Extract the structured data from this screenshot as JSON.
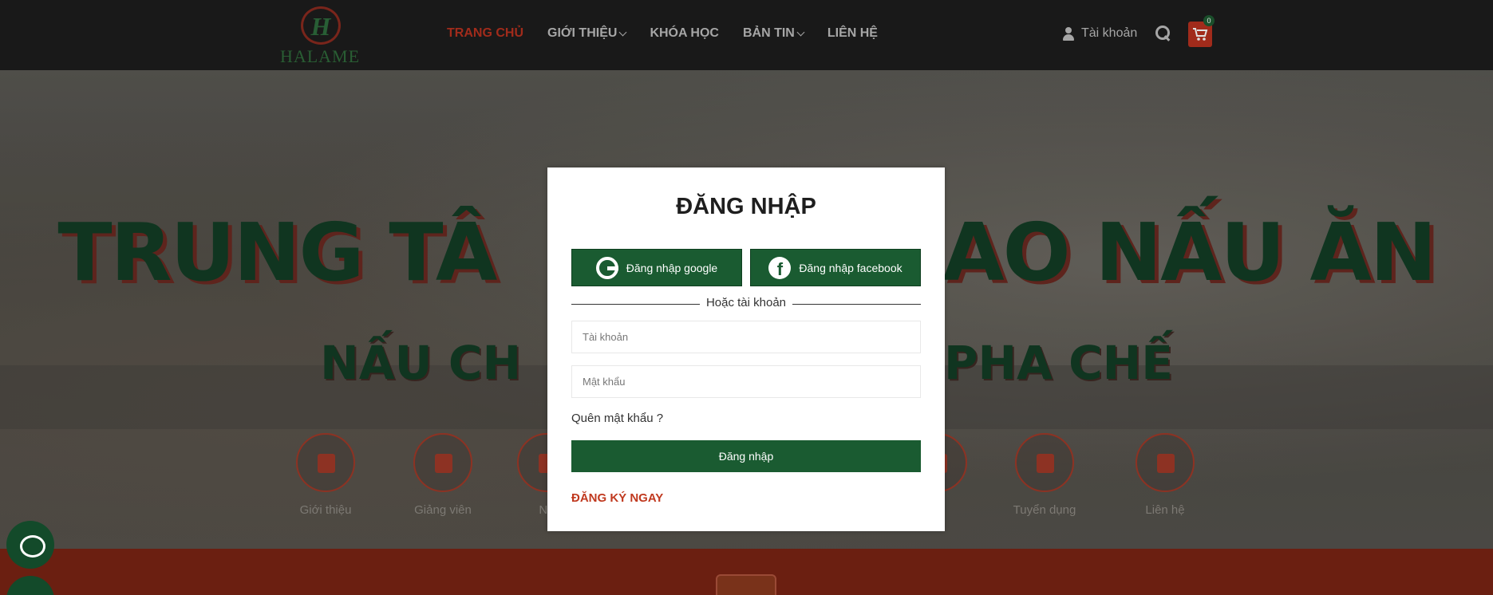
{
  "header": {
    "logo_text": "HALAME",
    "nav": [
      {
        "label": "TRANG CHỦ",
        "active": true,
        "has_dropdown": false
      },
      {
        "label": "GIỚI THIỆU",
        "active": false,
        "has_dropdown": true
      },
      {
        "label": "KHÓA HỌC",
        "active": false,
        "has_dropdown": false
      },
      {
        "label": "BẢN TIN",
        "active": false,
        "has_dropdown": true
      },
      {
        "label": "LIÊN HỆ",
        "active": false,
        "has_dropdown": false
      }
    ],
    "account_label": "Tài khoản",
    "cart_count": "0"
  },
  "hero": {
    "title_left": "TRUNG TÂ",
    "title_right": "AO NẤU ĂN",
    "subtitle_left": "NẤU CH",
    "subtitle_right": "PHA CHẾ",
    "features": [
      {
        "label": "Giới thiệu",
        "icon": "document-icon"
      },
      {
        "label": "Giảng viên",
        "icon": "chef-icon"
      },
      {
        "label": "Ng",
        "icon": "book-icon"
      },
      {
        "label": "",
        "icon": "badge-icon"
      },
      {
        "label": "Tuyển dụng",
        "icon": "recruit-icon"
      },
      {
        "label": "Liên hệ",
        "icon": "phone-icon"
      }
    ]
  },
  "modal": {
    "title": "ĐĂNG NHẬP",
    "google_label": "Đăng nhập google",
    "facebook_label": "Đăng nhập facebook",
    "divider_label": "Hoặc tài khoản",
    "username_placeholder": "Tài khoản",
    "password_placeholder": "Mật khẩu",
    "forgot_label": "Quên mật khẩu ?",
    "submit_label": "Đăng nhập",
    "register_label": "ĐĂNG KÝ NGAY"
  },
  "colors": {
    "primary_green": "#1a5b31",
    "accent_red": "#b8321f",
    "header_bg": "#1d1d1d"
  }
}
